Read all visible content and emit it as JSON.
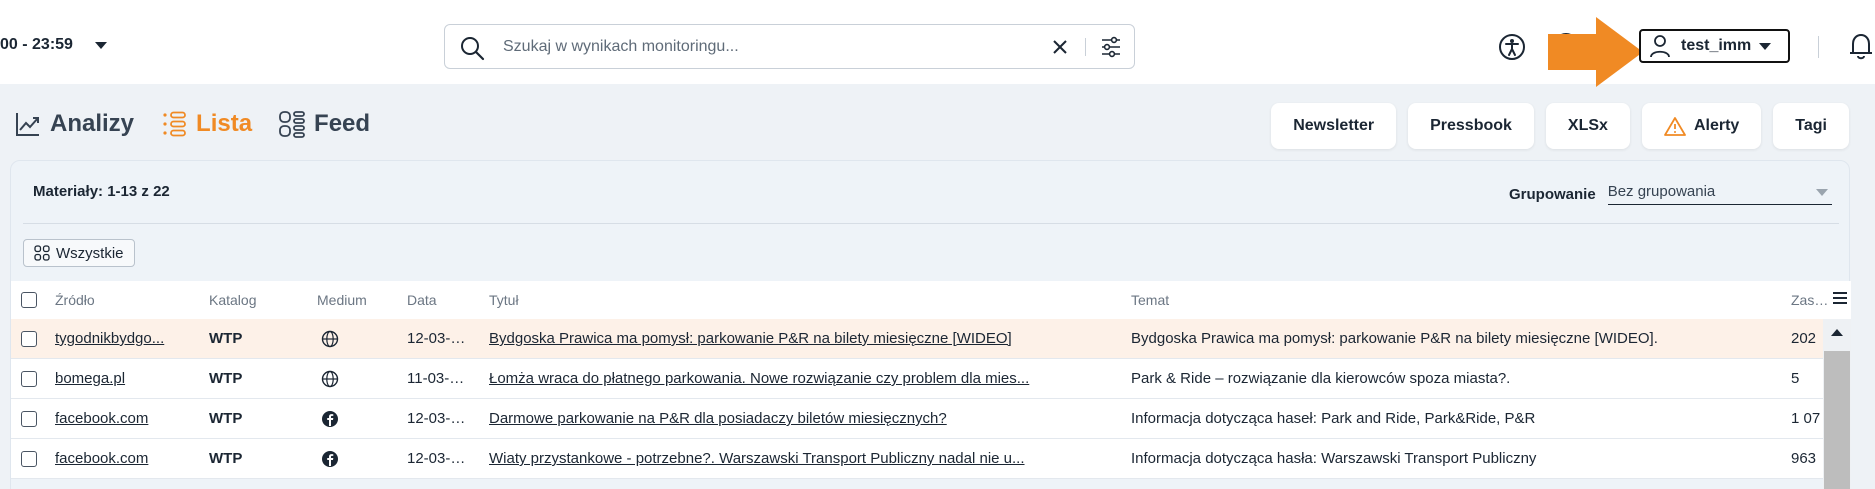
{
  "header": {
    "date_range": "00 - 23:59",
    "search": {
      "placeholder": "Szukaj w wynikach monitoringu..."
    },
    "user": {
      "name": "test_imm"
    },
    "accent_color": "#f08a24"
  },
  "tabs": [
    {
      "label": "Analizy",
      "icon": "chart-line-icon",
      "active": false
    },
    {
      "label": "Lista",
      "icon": "list-icon",
      "active": true
    },
    {
      "label": "Feed",
      "icon": "feed-grid-icon",
      "active": false
    }
  ],
  "actions": [
    {
      "label": "Newsletter"
    },
    {
      "label": "Pressbook"
    },
    {
      "label": "XLSx"
    },
    {
      "label": "Alerty",
      "icon": "warning-icon"
    },
    {
      "label": "Tagi"
    }
  ],
  "panel": {
    "materials_label": "Materiały:",
    "materials_range": "1-13 z",
    "materials_total": "22",
    "grouping_label": "Grupowanie",
    "grouping_value": "Bez grupowania",
    "filter_chip": "Wszystkie"
  },
  "table": {
    "columns": [
      "Źródło",
      "Katalog",
      "Medium",
      "Data",
      "Tytuł",
      "Temat",
      "Zasięg"
    ],
    "rows": [
      {
        "source": "tygodnikbydgo...",
        "catalog": "WTP",
        "medium": "web",
        "date": "12-03-2...",
        "title": "Bydgoska Prawica ma pomysł: parkowanie P&R na bilety miesięczne [WIDEO]",
        "topic": "Bydgoska Prawica ma pomysł: parkowanie P&R na bilety miesięczne [WIDEO].",
        "reach": "202",
        "highlighted": true
      },
      {
        "source": "bomega.pl",
        "catalog": "WTP",
        "medium": "web",
        "date": "11-03-2...",
        "title": "Łomża wraca do płatnego parkowania. Nowe rozwiązanie czy problem dla mies...",
        "topic": "Park & Ride – rozwiązanie dla kierowców spoza miasta?.",
        "reach": "5",
        "highlighted": false
      },
      {
        "source": "facebook.com",
        "catalog": "WTP",
        "medium": "facebook",
        "date": "12-03-2...",
        "title": "Darmowe parkowanie na P&R dla posiadaczy biletów miesięcznych?",
        "topic": "Informacja dotycząca haseł: Park and Ride, Park&Ride, P&R",
        "reach": "1 07",
        "highlighted": false
      },
      {
        "source": "facebook.com",
        "catalog": "WTP",
        "medium": "facebook",
        "date": "12-03-2...",
        "title": "Wiaty przystankowe - potrzebne?. Warszawski Transport Publiczny nadal nie u...",
        "topic": "Informacja dotycząca hasła: Warszawski Transport Publiczny",
        "reach": "963",
        "highlighted": false
      }
    ]
  }
}
